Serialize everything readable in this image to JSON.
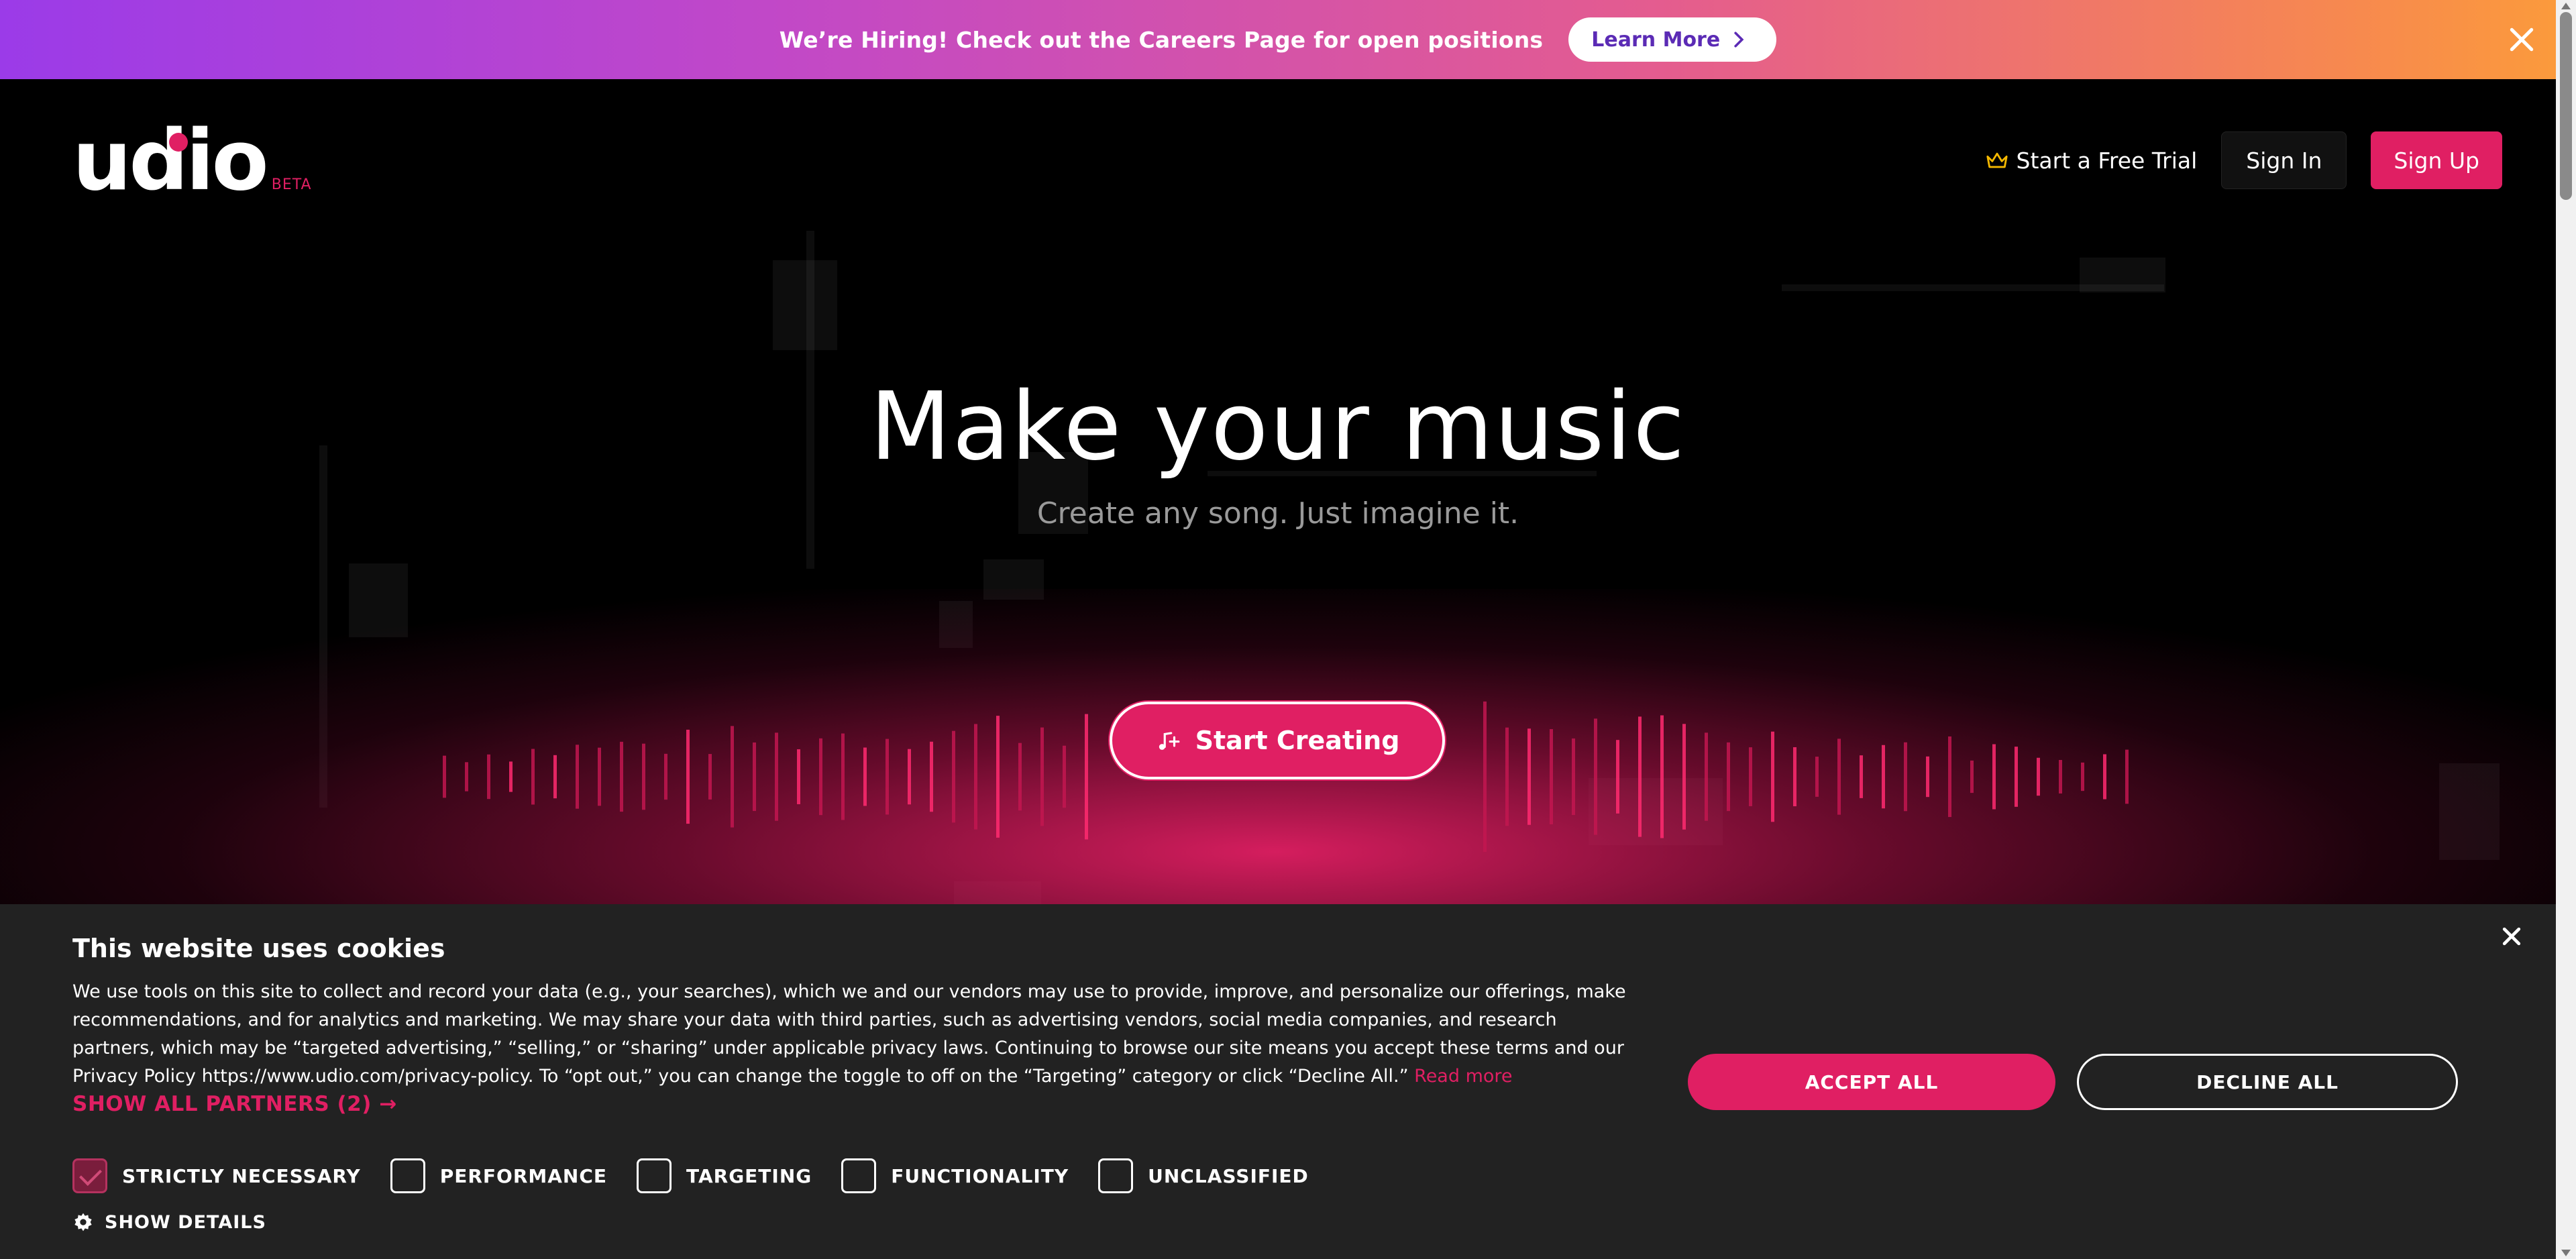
{
  "banner": {
    "text": "We’re Hiring! Check out the Careers Page for open positions",
    "button_label": "Learn More",
    "icons": {
      "chevron": "chevron-right-icon",
      "close": "close-icon"
    }
  },
  "header": {
    "logo_text": "udio",
    "logo_badge": "BETA",
    "trial_label": "Start a Free Trial",
    "signin_label": "Sign In",
    "signup_label": "Sign Up",
    "icons": {
      "trial": "crown-icon"
    }
  },
  "hero": {
    "title": "Make your music",
    "subtitle": "Create any song. Just imagine it.",
    "cta_label": "Start Creating",
    "icons": {
      "cta": "music-note-plus-icon"
    }
  },
  "cookie": {
    "title": "This website uses cookies",
    "body": "We use tools on this site to collect and record your data (e.g., your searches), which we and our vendors may use to provide, improve, and personalize our offerings, make recommendations, and for analytics and marketing. We may share your data with third parties, such as advertising vendors, social media companies, and research partners, which may be “targeted advertising,” “selling,” or “sharing” under applicable privacy laws. Continuing to browse our site means you accept these terms and our Privacy Policy https://www.udio.com/privacy-policy. To “opt out,” you can change the toggle to off on the “Targeting” category or click “Decline All.” ",
    "read_more": "Read more",
    "show_partners": "SHOW ALL PARTNERS (2) →",
    "categories": [
      {
        "label": "STRICTLY NECESSARY",
        "checked": true
      },
      {
        "label": "PERFORMANCE",
        "checked": false
      },
      {
        "label": "TARGETING",
        "checked": false
      },
      {
        "label": "FUNCTIONALITY",
        "checked": false
      },
      {
        "label": "UNCLASSIFIED",
        "checked": false
      }
    ],
    "show_details": "SHOW DETAILS",
    "accept_label": "ACCEPT ALL",
    "decline_label": "DECLINE ALL",
    "icons": {
      "close": "close-icon",
      "details": "gear-icon"
    }
  },
  "colors": {
    "accent": "#e01f63",
    "banner_gradient_start": "#9b3be8",
    "banner_gradient_end": "#fb9a3c",
    "cookie_panel": "#222222",
    "background": "#000000"
  }
}
